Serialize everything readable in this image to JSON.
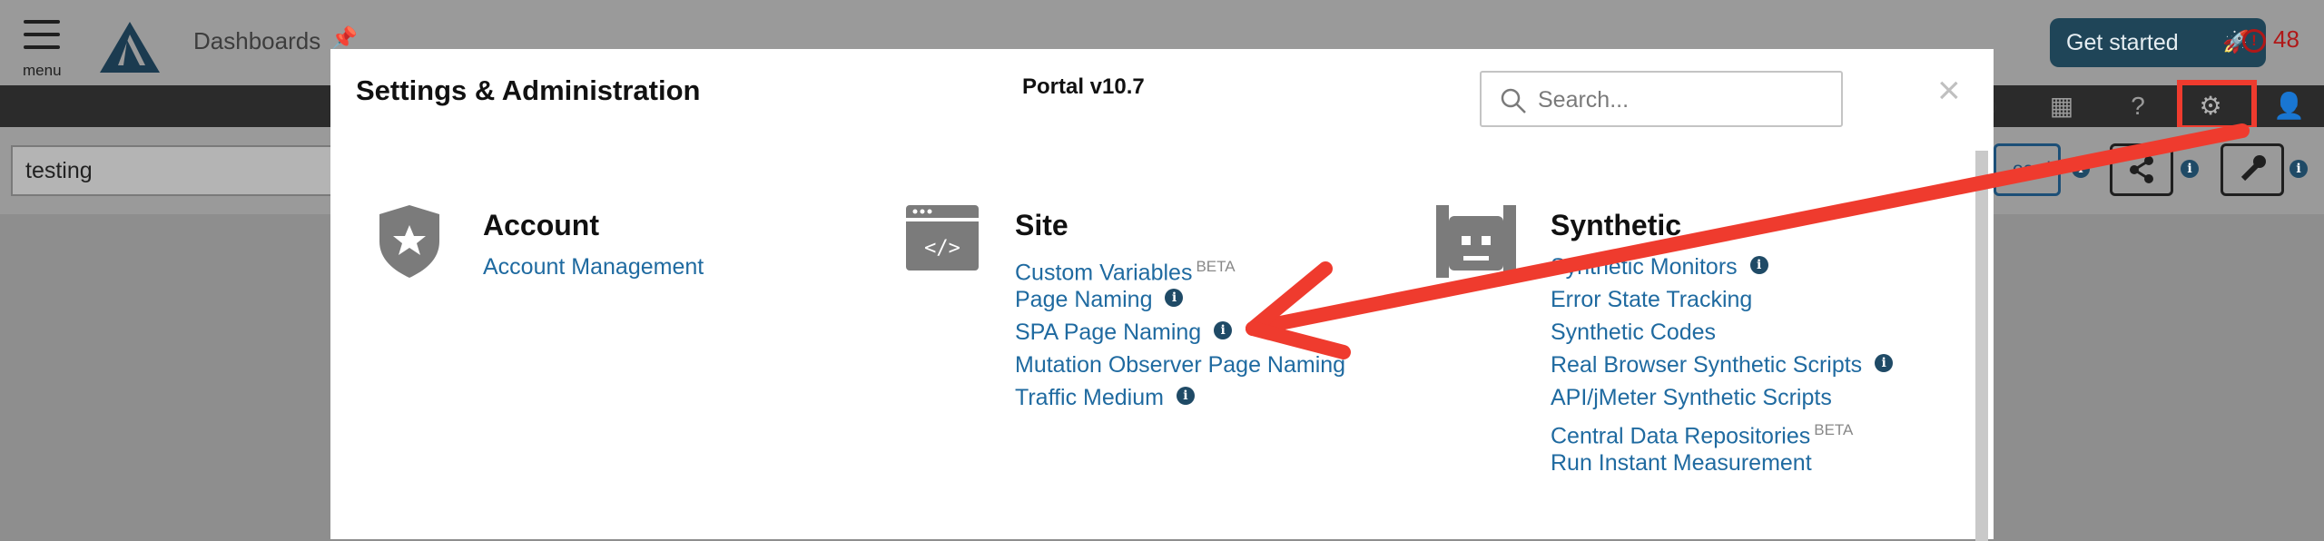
{
  "app": {
    "menu_label": "menu",
    "dashboards_label": "Dashboards",
    "get_started_label": "Get started",
    "alert_count": "48",
    "dashboard_name": "testing",
    "dashboard_button_label": "oard"
  },
  "modal": {
    "title": "Settings & Administration",
    "version": "Portal v10.7",
    "search_placeholder": "Search...",
    "close_label": "×",
    "sections": [
      {
        "title": "Account",
        "icon": "shield-star-icon",
        "links": [
          {
            "label": "Account Management",
            "info": false,
            "beta": ""
          }
        ]
      },
      {
        "title": "Site",
        "icon": "code-window-icon",
        "links": [
          {
            "label": "Custom Variables",
            "info": false,
            "beta": "BETA"
          },
          {
            "label": "Page Naming",
            "info": true,
            "beta": ""
          },
          {
            "label": "SPA Page Naming",
            "info": true,
            "beta": ""
          },
          {
            "label": "Mutation Observer Page Naming",
            "info": false,
            "beta": ""
          },
          {
            "label": "Traffic Medium",
            "info": true,
            "beta": ""
          }
        ]
      },
      {
        "title": "Synthetic",
        "icon": "robot-icon",
        "links": [
          {
            "label": "Synthetic Monitors",
            "info": true,
            "beta": ""
          },
          {
            "label": "Error State Tracking",
            "info": false,
            "beta": ""
          },
          {
            "label": "Synthetic Codes",
            "info": false,
            "beta": ""
          },
          {
            "label": "Real Browser Synthetic Scripts",
            "info": true,
            "beta": ""
          },
          {
            "label": "API/jMeter Synthetic Scripts",
            "info": false,
            "beta": ""
          },
          {
            "label": "Central Data Repositories",
            "info": false,
            "beta": "BETA"
          },
          {
            "label": "Run Instant Measurement",
            "info": false,
            "beta": ""
          }
        ]
      }
    ]
  },
  "colors": {
    "link": "#1f6aa0",
    "annotation": "#ef3b2e",
    "overlay": "#8e8e8e",
    "info_dot": "#1f4a66"
  }
}
